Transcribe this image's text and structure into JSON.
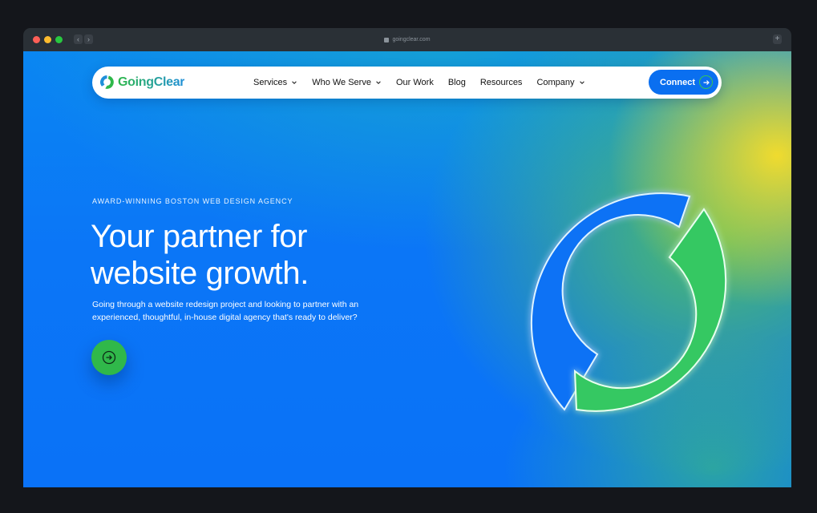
{
  "browser": {
    "url": "goingclear.com"
  },
  "nav": {
    "logo_text": "GoingClear",
    "items": [
      {
        "label": "Services",
        "dropdown": true
      },
      {
        "label": "Who We Serve",
        "dropdown": true
      },
      {
        "label": "Our Work",
        "dropdown": false
      },
      {
        "label": "Blog",
        "dropdown": false
      },
      {
        "label": "Resources",
        "dropdown": false
      },
      {
        "label": "Company",
        "dropdown": true
      }
    ],
    "connect_label": "Connect"
  },
  "hero": {
    "eyebrow": "AWARD-WINNING BOSTON WEB DESIGN AGENCY",
    "headline_line1": "Your partner for",
    "headline_line2": "website growth.",
    "subtext_line1": "Going through a website redesign project and looking to partner with an",
    "subtext_line2": "experienced, thoughtful, in-house digital agency that's ready to deliver?"
  },
  "icons": {
    "logo": "goingclear-logo-icon",
    "caret": "chevron-down-icon",
    "connect_arrow": "arrow-right-circle-icon",
    "cta_arrow": "arrow-right-circle-icon"
  },
  "colors": {
    "brand_blue": "#0a6ff0",
    "brand_green": "#34c759",
    "accent_yellow": "#fade28",
    "background_blue": "#0b76f7"
  }
}
